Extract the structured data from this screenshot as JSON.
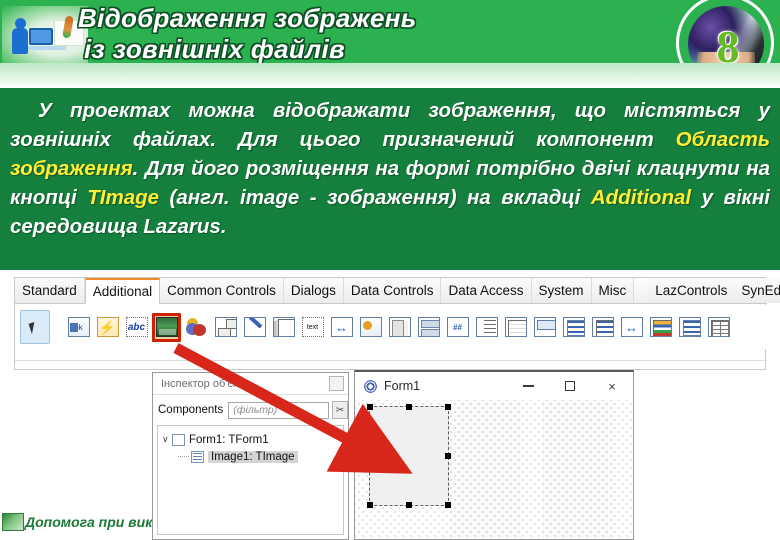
{
  "header": {
    "title_line1": "Відображення зображень",
    "title_line2": "із зовнішніх файлів",
    "badge_number": "8",
    "illustration_name": "student-at-computer-illustration"
  },
  "content": {
    "paragraph_parts": [
      {
        "text": "    У проектах можна відображати зображення, що містяться у зовнішніх файлах. Для цього призначений компонент ",
        "highlight": false
      },
      {
        "text": "Область зображення",
        "highlight": true
      },
      {
        "text": ". Для його розміщення на формі потрібно двічі клацнути на кнопці ",
        "highlight": false
      },
      {
        "text": "TImage",
        "highlight": true
      },
      {
        "text": " (англ. image - зображення) на вкладці ",
        "highlight": false
      },
      {
        "text": "Additional",
        "highlight": true
      },
      {
        "text": " у вікні середовища Lazarus.",
        "highlight": false
      }
    ],
    "highlight_color": "#ffee33",
    "text_color": "#ffffff",
    "background_color": "#15803d"
  },
  "palette": {
    "tabs": [
      {
        "label": "Standard",
        "active": false
      },
      {
        "label": "Additional",
        "active": true
      },
      {
        "label": "Common Controls",
        "active": false
      },
      {
        "label": "Dialogs",
        "active": false
      },
      {
        "label": "Data Controls",
        "active": false
      },
      {
        "label": "Data Access",
        "active": false
      },
      {
        "label": "System",
        "active": false
      },
      {
        "label": "Misc",
        "active": false
      },
      {
        "label": "LazControls",
        "active": false
      },
      {
        "label": "SynEdit",
        "active": false
      }
    ],
    "selection_tool": "pointer-arrow-icon",
    "highlighted_tool": "timage-icon",
    "highlight_border_color": "#cc2200",
    "tools": [
      {
        "name": "button-ok-icon",
        "cls": "btnok",
        "text": "ok"
      },
      {
        "name": "speed-button-icon",
        "cls": "speed",
        "text": ""
      },
      {
        "name": "static-text-abc-icon",
        "cls": "abc",
        "text": "abc"
      },
      {
        "name": "timage-icon",
        "cls": "timage",
        "text": ""
      },
      {
        "name": "shape-icon",
        "cls": "shape",
        "text": ""
      },
      {
        "name": "panel-icon",
        "cls": "panel",
        "text": ""
      },
      {
        "name": "paint-box-icon",
        "cls": "pen",
        "text": ""
      },
      {
        "name": "notebook-icon",
        "cls": "notebook",
        "text": ""
      },
      {
        "name": "label-edit-icon",
        "cls": "textlabel",
        "text": "text"
      },
      {
        "name": "splitter-icon",
        "cls": "splitter",
        "text": ""
      },
      {
        "name": "color-button-icon",
        "cls": "colored",
        "text": ""
      },
      {
        "name": "pages-icon",
        "cls": "pages",
        "text": ""
      },
      {
        "name": "split-panel-icon",
        "cls": "splitbar",
        "text": ""
      },
      {
        "name": "masked-edit-icon",
        "cls": "maskedit",
        "text": "##"
      },
      {
        "name": "check-list-box-icon",
        "cls": "checklist",
        "text": ""
      },
      {
        "name": "scroll-box-icon",
        "cls": "grid",
        "text": ""
      },
      {
        "name": "combo-box-ex-icon",
        "cls": "combo",
        "text": ""
      },
      {
        "name": "list-box-abc-icon",
        "cls": "listbox",
        "text": ""
      },
      {
        "name": "list-view-icon",
        "cls": "treeview",
        "text": ""
      },
      {
        "name": "control-bar-icon",
        "cls": "splitter",
        "text": ""
      },
      {
        "name": "color-list-box-icon",
        "cls": "colorbar",
        "text": ""
      },
      {
        "name": "color-box-icon",
        "cls": "listbox",
        "text": ""
      },
      {
        "name": "string-grid-icon",
        "cls": "tbl",
        "text": ""
      }
    ]
  },
  "inspector": {
    "window_title": "Інспектор об'єкта",
    "components_label": "Components",
    "filter_placeholder": "(фільтр)",
    "filter_value": "",
    "filter_button_icon": "clear-filter-icon",
    "tree": [
      {
        "label": "Form1: TForm1",
        "selected": false,
        "child": false
      },
      {
        "label": "Image1: TImage",
        "selected": true,
        "child": true
      }
    ]
  },
  "form_window": {
    "title": "Form1",
    "icon": "lazarus-form-icon",
    "minimize_label": "–",
    "maximize_label": "□",
    "close_label": "×",
    "selected_component": "Image1"
  },
  "footer": {
    "text": "Допомога при вик"
  }
}
